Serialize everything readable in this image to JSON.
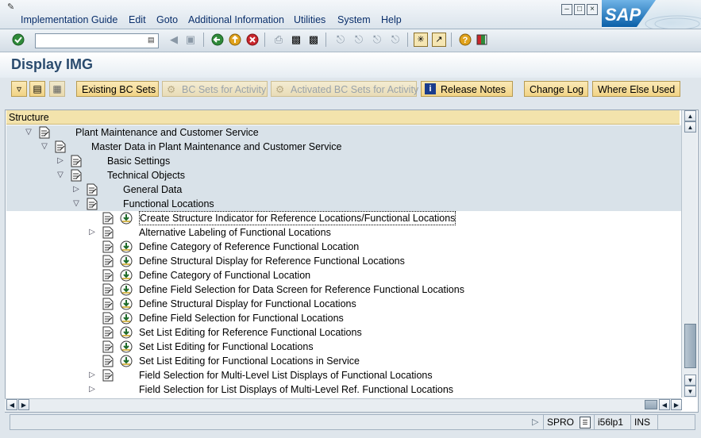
{
  "menu": {
    "items": [
      "Implementation Guide",
      "Edit",
      "Goto",
      "Additional Information",
      "Utilities",
      "System",
      "Help"
    ]
  },
  "brand": {
    "logo_text": "SAP",
    "accent": "#0a6fb5"
  },
  "toolbar": {
    "command_value": "",
    "icons": [
      "enter-icon",
      "save-icon",
      "back-icon",
      "exit-icon",
      "cancel-icon",
      "print-icon",
      "find-icon",
      "find-next-icon",
      "first-page-icon",
      "prev-page-icon",
      "next-page-icon",
      "last-page-icon",
      "create-session-icon",
      "shortcut-icon",
      "help-icon",
      "layout-icon"
    ]
  },
  "page": {
    "title": "Display IMG"
  },
  "app_toolbar": {
    "existing_bc_sets": "Existing BC Sets",
    "bc_sets_for_activity": "BC Sets for Activity",
    "activated_bc_sets": "Activated BC Sets for Activity",
    "release_notes": "Release Notes",
    "change_log": "Change Log",
    "where_else_used": "Where Else Used"
  },
  "tree": {
    "header": "Structure",
    "rows": [
      {
        "label": "Plant Maintenance and Customer Service",
        "level": 1,
        "expander": "expanded",
        "exec": false,
        "highlight": true
      },
      {
        "label": "Master Data in Plant Maintenance and Customer Service",
        "level": 2,
        "expander": "expanded",
        "exec": false,
        "highlight": true
      },
      {
        "label": "Basic Settings",
        "level": 3,
        "expander": "collapsed",
        "exec": false,
        "highlight": true
      },
      {
        "label": "Technical Objects",
        "level": 3,
        "expander": "expanded",
        "exec": false,
        "highlight": true
      },
      {
        "label": "General Data",
        "level": 4,
        "expander": "collapsed",
        "exec": false,
        "highlight": true
      },
      {
        "label": "Functional Locations",
        "level": 4,
        "expander": "expanded",
        "exec": false,
        "highlight": true
      },
      {
        "label": "Create Structure Indicator for Reference Locations/Functional Locations",
        "level": 5,
        "expander": "none",
        "exec": true,
        "highlight": false,
        "selected": true
      },
      {
        "label": "Alternative Labeling of Functional Locations",
        "level": 5,
        "expander": "collapsed",
        "exec": false,
        "highlight": false
      },
      {
        "label": "Define Category of Reference Functional Location",
        "level": 5,
        "expander": "none",
        "exec": true,
        "highlight": false
      },
      {
        "label": "Define Structural Display for Reference Functional Locations",
        "level": 5,
        "expander": "none",
        "exec": true,
        "highlight": false
      },
      {
        "label": "Define Category of Functional Location",
        "level": 5,
        "expander": "none",
        "exec": true,
        "highlight": false
      },
      {
        "label": "Define Field Selection for Data Screen for Reference Functional Locations",
        "level": 5,
        "expander": "none",
        "exec": true,
        "highlight": false
      },
      {
        "label": "Define Structural Display for Functional Locations",
        "level": 5,
        "expander": "none",
        "exec": true,
        "highlight": false
      },
      {
        "label": "Define Field Selection for Functional Locations",
        "level": 5,
        "expander": "none",
        "exec": true,
        "highlight": false
      },
      {
        "label": "Set List Editing for Reference Functional Locations",
        "level": 5,
        "expander": "none",
        "exec": true,
        "highlight": false
      },
      {
        "label": "Set List Editing for Functional Locations",
        "level": 5,
        "expander": "none",
        "exec": true,
        "highlight": false
      },
      {
        "label": "Set List Editing for Functional Locations in Service",
        "level": 5,
        "expander": "none",
        "exec": true,
        "highlight": false
      },
      {
        "label": "Field Selection for Multi-Level List Displays of Functional Locations",
        "level": 5,
        "expander": "collapsed",
        "exec": false,
        "highlight": false
      },
      {
        "label": "Field Selection for List Displays of Multi-Level Ref. Functional Locations",
        "level": 5,
        "expander": "collapsed",
        "exec": false,
        "highlight": false,
        "no_doc": true
      }
    ]
  },
  "status": {
    "transaction": "SPRO",
    "server": "i56lp1",
    "mode": "INS"
  }
}
